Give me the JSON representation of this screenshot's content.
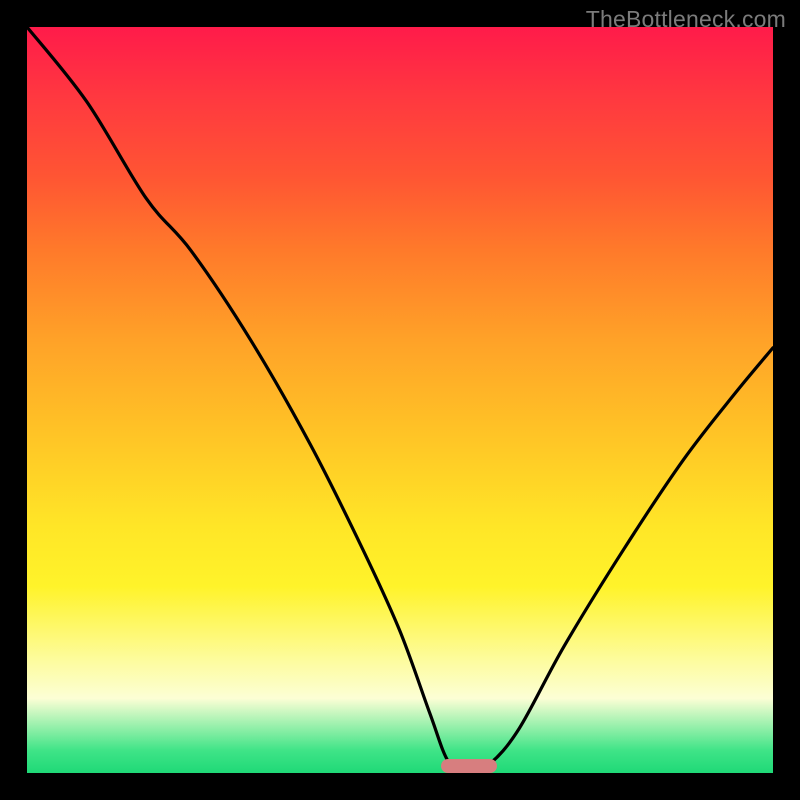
{
  "watermark": "TheBottleneck.com",
  "colors": {
    "background": "#000000",
    "gradient_top": "#ff1b4a",
    "gradient_bottom": "#1fd977",
    "curve": "#000000",
    "marker": "#d77e7f"
  },
  "marker": {
    "x_frac_start": 0.555,
    "x_frac_end": 0.63,
    "y_frac": 0.99
  },
  "chart_data": {
    "type": "line",
    "title": "",
    "xlabel": "",
    "ylabel": "",
    "xlim": [
      0,
      1
    ],
    "ylim": [
      0,
      1
    ],
    "series": [
      {
        "name": "bottleneck-curve",
        "points": [
          {
            "x": 0.0,
            "y": 1.0
          },
          {
            "x": 0.08,
            "y": 0.9
          },
          {
            "x": 0.16,
            "y": 0.77
          },
          {
            "x": 0.22,
            "y": 0.7
          },
          {
            "x": 0.3,
            "y": 0.58
          },
          {
            "x": 0.38,
            "y": 0.44
          },
          {
            "x": 0.45,
            "y": 0.3
          },
          {
            "x": 0.5,
            "y": 0.19
          },
          {
            "x": 0.54,
            "y": 0.08
          },
          {
            "x": 0.565,
            "y": 0.015
          },
          {
            "x": 0.59,
            "y": 0.003
          },
          {
            "x": 0.62,
            "y": 0.012
          },
          {
            "x": 0.66,
            "y": 0.06
          },
          {
            "x": 0.72,
            "y": 0.17
          },
          {
            "x": 0.8,
            "y": 0.3
          },
          {
            "x": 0.88,
            "y": 0.42
          },
          {
            "x": 0.95,
            "y": 0.51
          },
          {
            "x": 1.0,
            "y": 0.57
          }
        ]
      }
    ],
    "annotations": [
      {
        "type": "marker",
        "x_range": [
          0.555,
          0.63
        ],
        "y": 0.005,
        "color": "#d77e7f"
      }
    ]
  }
}
